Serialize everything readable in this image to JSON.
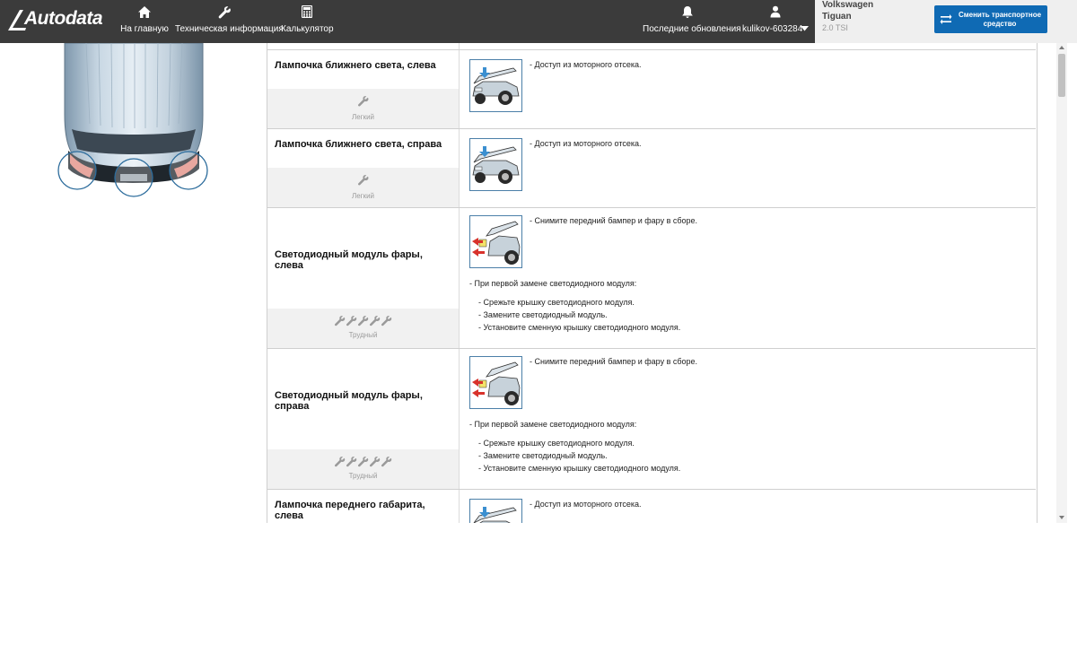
{
  "brand": {
    "logo_text": "Autodata"
  },
  "nav": {
    "home": "На главную",
    "tech": "Техническая информация",
    "calc": "Калькулятор",
    "updates": "Последние обновления",
    "user": "kulikov-603284"
  },
  "vehicle": {
    "make": "Volkswagen",
    "model": "Tiguan",
    "engine": "2.0 TSI",
    "change_button": "Сменить транспортное средство"
  },
  "rows": [
    {
      "name": "Лампочка ближнего света, слева",
      "difficulty_label": "Легкий",
      "difficulty_level": 1,
      "image": "car-hood-open",
      "step": "- Доступ из моторного отсека."
    },
    {
      "name": "Лампочка ближнего света, справа",
      "difficulty_label": "Легкий",
      "difficulty_level": 1,
      "image": "car-hood-open",
      "step": "- Доступ из моторного отсека."
    },
    {
      "name": "Светодиодный модуль фары, слева",
      "difficulty_label": "Трудный",
      "difficulty_level": 5,
      "image": "car-bumper-removal",
      "step": "- Снимите передний бампер и фару в сборе.",
      "note": "- При первой замене светодиодного модуля:",
      "substeps": [
        "- Срежьте крышку светодиодного модуля.",
        "- Замените светодиодный модуль.",
        "- Установите сменную крышку светодиодного модуля."
      ]
    },
    {
      "name": "Светодиодный модуль фары, справа",
      "difficulty_label": "Трудный",
      "difficulty_level": 5,
      "image": "car-bumper-removal",
      "step": "- Снимите передний бампер и фару в сборе.",
      "note": "- При первой замене светодиодного модуля:",
      "substeps": [
        "- Срежьте крышку светодиодного модуля.",
        "- Замените светодиодный модуль.",
        "- Установите сменную крышку светодиодного модуля."
      ]
    },
    {
      "name": "Лампочка переднего габарита, слева",
      "image": "car-hood-open",
      "step": "- Доступ из моторного отсека."
    }
  ],
  "colors": {
    "topbar": "#3b3b3b",
    "accent": "#0f6ab4",
    "difficulty_bg": "#f1f1f1",
    "border": "#cfcfcf"
  }
}
